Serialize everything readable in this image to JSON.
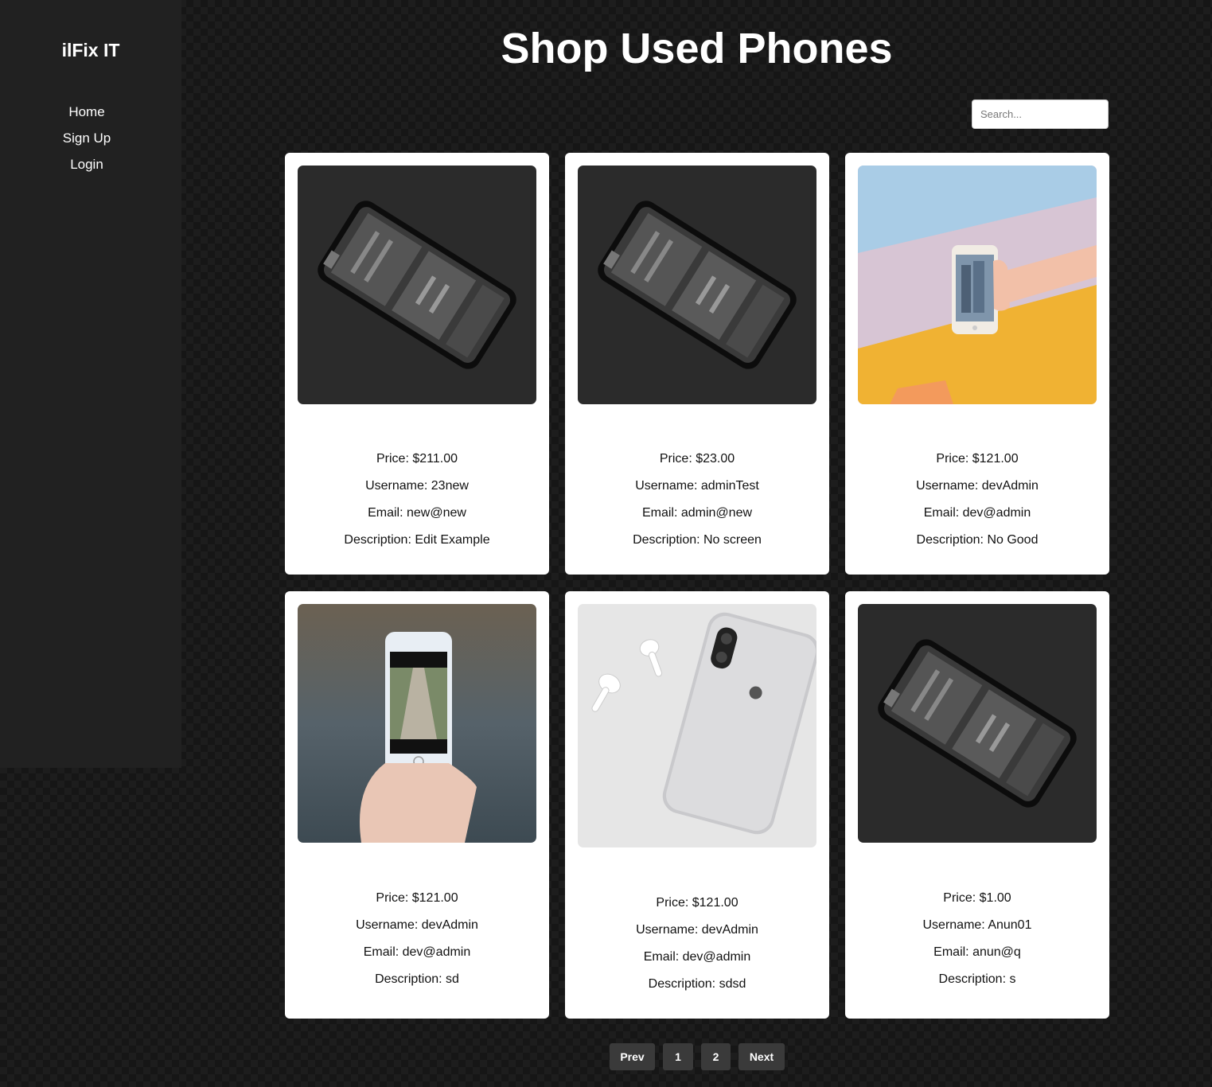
{
  "sidebar": {
    "brand": "ilFix IT",
    "nav": [
      "Home",
      "Sign Up",
      "Login"
    ]
  },
  "page": {
    "title": "Shop Used Phones"
  },
  "search": {
    "placeholder": "Search..."
  },
  "listings": [
    {
      "price": "Price: $211.00",
      "username": "Username: 23new",
      "email": "Email: new@new",
      "description": "Description: Edit Example",
      "image": "phone-internals-photo"
    },
    {
      "price": "Price: $23.00",
      "username": "Username: adminTest",
      "email": "Email: admin@new",
      "description": "Description: No screen",
      "image": "phone-internals-photo"
    },
    {
      "price": "Price: $121.00",
      "username": "Username: devAdmin",
      "email": "Email: dev@admin",
      "description": "Description: No Good",
      "image": "hand-holding-phone-on-pastel-wall-photo"
    },
    {
      "price": "Price: $121.00",
      "username": "Username: devAdmin",
      "email": "Email: dev@admin",
      "description": "Description: sd",
      "image": "hand-holding-phone-forest-path-photo"
    },
    {
      "price": "Price: $121.00",
      "username": "Username: devAdmin",
      "email": "Email: dev@admin",
      "description": "Description: sdsd",
      "image": "white-iphone-with-earbuds-photo"
    },
    {
      "price": "Price: $1.00",
      "username": "Username: Anun01",
      "email": "Email: anun@q",
      "description": "Description: s",
      "image": "phone-internals-photo"
    }
  ],
  "pagination": {
    "prev": "Prev",
    "page1": "1",
    "page2": "2",
    "next": "Next"
  },
  "colors": {
    "sidebar_bg": "#212121",
    "page_bg": "#161616",
    "card_bg": "#ffffff",
    "pager_bg": "#3a3a3a"
  }
}
